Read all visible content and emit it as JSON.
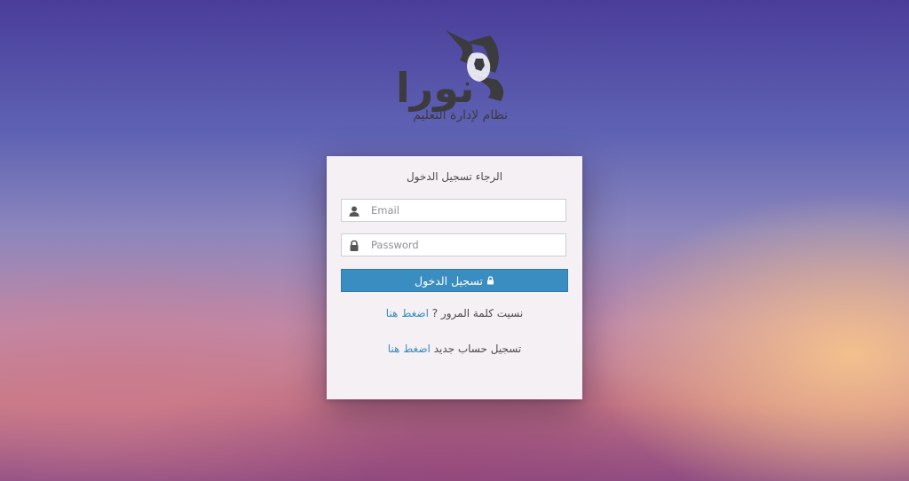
{
  "logo": {
    "word": "نورا",
    "tagline": "نظام لإدارة التعليم"
  },
  "login": {
    "title": "الرجاء تسجيل الدخول",
    "email_placeholder": "Email",
    "password_placeholder": "Password",
    "button_label": "تسجيل الدخول",
    "forgot_text": "نسيت كلمة المرور ?",
    "forgot_link": "اضغط هنا",
    "register_text": "تسجيل حساب جديد",
    "register_link": "اضغط هنا"
  },
  "icons": {
    "email": "user-icon",
    "password": "lock-icon",
    "button": "lock-icon"
  },
  "colors": {
    "accent": "#3a8dc1",
    "logo": "#3b3b40",
    "card": "#f5f0f3"
  }
}
